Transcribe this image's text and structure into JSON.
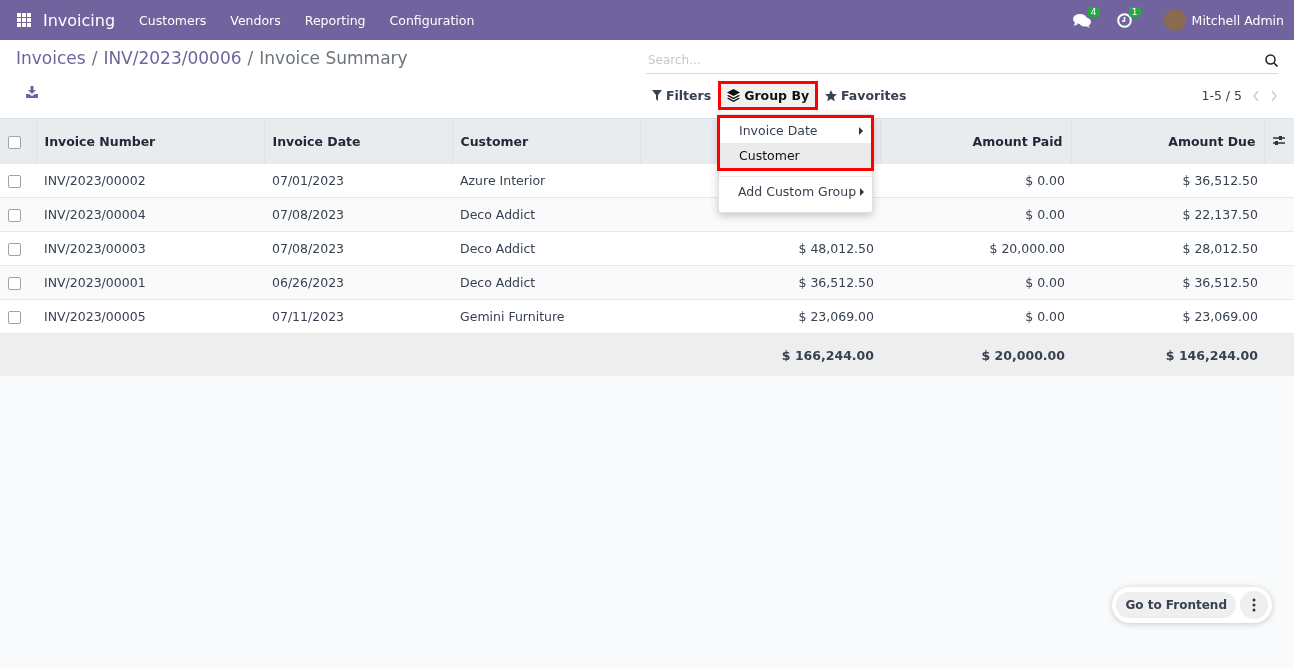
{
  "navbar": {
    "app": "Invoicing",
    "menu": [
      "Customers",
      "Vendors",
      "Reporting",
      "Configuration"
    ],
    "messages_badge": "4",
    "activities_badge": "1",
    "user": "Mitchell Admin"
  },
  "breadcrumb": {
    "items": [
      "Invoices",
      "INV/2023/00006",
      "Invoice Summary"
    ],
    "separator": "/"
  },
  "search": {
    "placeholder": "Search..."
  },
  "filters": [
    {
      "label": "Filters",
      "kind": "filter",
      "selected": false
    },
    {
      "label": "Group By",
      "kind": "group",
      "selected": true
    },
    {
      "label": "Favorites",
      "kind": "star",
      "selected": false
    }
  ],
  "pager": "1-5 / 5",
  "dropdown": [
    {
      "label": "Invoice Date",
      "submenu": true,
      "selected": false
    },
    {
      "label": "Customer",
      "submenu": false,
      "selected": true
    },
    {
      "label": "Add Custom Group",
      "submenu": true,
      "selected": false
    }
  ],
  "table": {
    "select_all_checked": false,
    "columns": [
      "Invoice Number",
      "Invoice Date",
      "Customer",
      "Amount Paid",
      "Amount Due"
    ],
    "rows": [
      {
        "checked": false,
        "number": "INV/2023/00002",
        "date": "07/01/2023",
        "customer": "Azure Interior",
        "paid": "$ 0.00",
        "due": "$ 36,512.50"
      },
      {
        "checked": false,
        "number": "INV/2023/00004",
        "date": "07/08/2023",
        "customer": "Deco Addict",
        "paid": "$ 0.00",
        "due": "$ 22,137.50"
      },
      {
        "checked": false,
        "number": "INV/2023/00003",
        "date": "07/08/2023",
        "customer": "Deco Addict",
        "total": "$ 48,012.50",
        "paid": "$ 20,000.00",
        "due": "$ 28,012.50"
      },
      {
        "checked": false,
        "number": "INV/2023/00001",
        "date": "06/26/2023",
        "customer": "Deco Addict",
        "total": "$ 36,512.50",
        "paid": "$ 0.00",
        "due": "$ 36,512.50"
      },
      {
        "checked": false,
        "number": "INV/2023/00005",
        "date": "07/11/2023",
        "customer": "Gemini Furniture",
        "total": "$ 23,069.00",
        "paid": "$ 0.00",
        "due": "$ 23,069.00"
      }
    ],
    "totals": [
      "$ 166,244.00",
      "$ 20,000.00",
      "$ 146,244.00"
    ]
  },
  "frontend_button": "Go to Frontend"
}
